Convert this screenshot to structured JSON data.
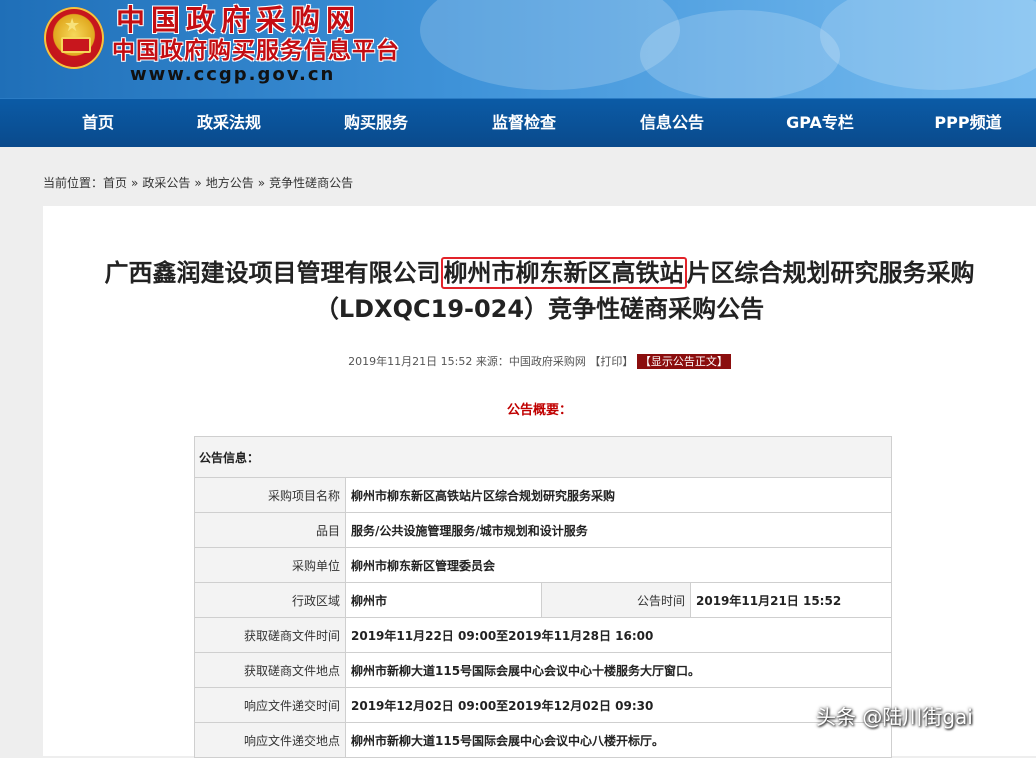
{
  "header": {
    "site_name": "中国政府采购网",
    "site_sub": "中国政府购买服务信息平台",
    "url": "www.ccgp.gov.cn"
  },
  "nav": {
    "items": [
      {
        "label": "首页"
      },
      {
        "label": "政采法规"
      },
      {
        "label": "购买服务"
      },
      {
        "label": "监督检查"
      },
      {
        "label": "信息公告"
      },
      {
        "label": "GPA专栏"
      },
      {
        "label": "PPP频道"
      }
    ]
  },
  "breadcrumb": {
    "prefix": "当前位置：",
    "items": [
      "首页",
      "政采公告",
      "地方公告",
      "竞争性磋商公告"
    ],
    "separator": "»"
  },
  "announcement": {
    "title_before": "广西鑫润建设项目管理有限公司",
    "title_highlight": "柳州市柳东新区高铁站",
    "title_after": "片区综合规划研究服务采购",
    "title_line2": "（LDXQC19-024）竞争性磋商采购公告",
    "meta_datetime": "2019年11月21日 15:52",
    "meta_source": "来源：中国政府采购网",
    "meta_print": "【打印】",
    "meta_show": "【显示公告正文】",
    "summary_heading": "公告概要："
  },
  "info_table": {
    "section_header": "公告信息：",
    "rows": [
      {
        "label": "采购项目名称",
        "value": "柳州市柳东新区高铁站片区综合规划研究服务采购"
      },
      {
        "label": "品目",
        "value": "服务/公共设施管理服务/城市规划和设计服务"
      },
      {
        "label": "采购单位",
        "value": "柳州市柳东新区管理委员会"
      },
      {
        "label": "获取磋商文件时间",
        "value": "2019年11月22日 09:00至2019年11月28日 16:00"
      },
      {
        "label": "获取磋商文件地点",
        "value": "柳州市新柳大道115号国际会展中心会议中心十楼服务大厅窗口。"
      },
      {
        "label": "响应文件递交时间",
        "value": "2019年12月02日 09:00至2019年12月02日 09:30"
      },
      {
        "label": "响应文件递交地点",
        "value": "柳州市新柳大道115号国际会展中心会议中心八楼开标厅。"
      }
    ],
    "split_row": {
      "label1": "行政区域",
      "value1": "柳州市",
      "label2": "公告时间",
      "value2": "2019年11月21日 15:52"
    }
  },
  "watermark": "头条 @陆川街gai",
  "colors": {
    "nav_bg": "#0a4a8c",
    "brand_red": "#c40d12",
    "highlight_border": "#e2232a",
    "summary_red": "#c00000",
    "show_button_bg": "#8b0e0e"
  }
}
